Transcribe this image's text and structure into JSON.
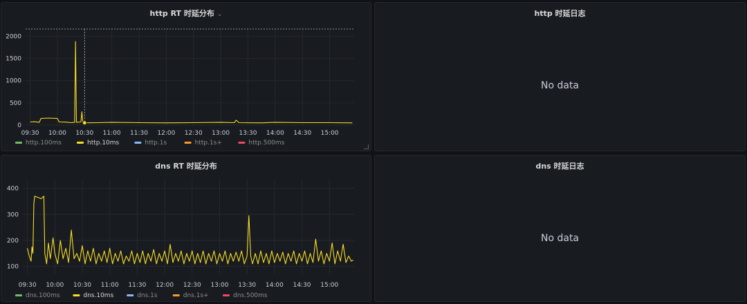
{
  "panels": {
    "http_rt": {
      "title": "http RT 时延分布"
    },
    "http_log": {
      "title": "http 时延日志",
      "empty_text": "No data"
    },
    "dns_rt": {
      "title": "dns RT 时延分布"
    },
    "dns_log": {
      "title": "dns 时延日志",
      "empty_text": "No data"
    }
  },
  "colors": {
    "series_100ms": "#73bf69",
    "series_10ms": "#fade2a",
    "series_1s": "#8ab8ff",
    "series_1s_plus": "#ff9830",
    "series_500ms": "#f2495c"
  },
  "chart_data": [
    {
      "type": "line",
      "title": "http RT 时延分布",
      "x_ticks": [
        "09:30",
        "10:00",
        "10:30",
        "11:00",
        "11:30",
        "12:00",
        "12:30",
        "13:00",
        "13:30",
        "14:00",
        "14:30",
        "15:00"
      ],
      "y_ticks": [
        0,
        500,
        1000,
        1500,
        2000
      ],
      "ylim": [
        0,
        2100
      ],
      "grid": true,
      "legend_placement": "bottom-left",
      "hover_time": "10:30",
      "series": [
        {
          "name": "http.100ms",
          "color": "#73bf69",
          "values": []
        },
        {
          "name": "http.10ms",
          "color": "#fade2a",
          "values": [
            [
              "09:30",
              70
            ],
            [
              "09:35",
              75
            ],
            [
              "09:40",
              60
            ],
            [
              "09:42",
              150
            ],
            [
              "09:50",
              155
            ],
            [
              "10:00",
              150
            ],
            [
              "10:02",
              70
            ],
            [
              "10:10",
              65
            ],
            [
              "10:15",
              55
            ],
            [
              "10:19",
              60
            ],
            [
              "10:20",
              1880
            ],
            [
              "10:21",
              60
            ],
            [
              "10:26",
              70
            ],
            [
              "10:27",
              300
            ],
            [
              "10:28",
              60
            ],
            [
              "10:30",
              50
            ],
            [
              "10:45",
              55
            ],
            [
              "11:00",
              60
            ],
            [
              "11:30",
              55
            ],
            [
              "12:00",
              50
            ],
            [
              "12:30",
              55
            ],
            [
              "13:00",
              60
            ],
            [
              "13:15",
              55
            ],
            [
              "13:17",
              110
            ],
            [
              "13:20",
              55
            ],
            [
              "13:45",
              50
            ],
            [
              "14:00",
              60
            ],
            [
              "14:30",
              55
            ],
            [
              "15:00",
              55
            ],
            [
              "15:25",
              50
            ]
          ]
        },
        {
          "name": "http.1s",
          "color": "#8ab8ff",
          "values": []
        },
        {
          "name": "http.1s+",
          "color": "#ff9830",
          "values": []
        },
        {
          "name": "http.500ms",
          "color": "#f2495c",
          "values": []
        }
      ]
    },
    {
      "type": "line",
      "title": "dns RT 时延分布",
      "x_ticks": [
        "09:30",
        "10:00",
        "10:30",
        "11:00",
        "11:30",
        "12:00",
        "12:30",
        "13:00",
        "13:30",
        "14:00",
        "14:30",
        "15:00"
      ],
      "y_ticks": [
        100,
        200,
        300,
        400
      ],
      "ylim": [
        70,
        420
      ],
      "grid": true,
      "legend_placement": "bottom-left",
      "series": [
        {
          "name": "dns.100ms",
          "color": "#73bf69",
          "values": []
        },
        {
          "name": "dns.10ms",
          "color": "#fade2a",
          "values": [
            [
              "09:30",
              170
            ],
            [
              "09:32",
              140
            ],
            [
              "09:34",
              120
            ],
            [
              "09:35",
              175
            ],
            [
              "09:36",
              150
            ],
            [
              "09:37",
              340
            ],
            [
              "09:38",
              370
            ],
            [
              "09:45",
              360
            ],
            [
              "09:48",
              370
            ],
            [
              "09:49",
              150
            ],
            [
              "09:51",
              110
            ],
            [
              "09:53",
              190
            ],
            [
              "09:55",
              130
            ],
            [
              "09:58",
              210
            ],
            [
              "10:00",
              150
            ],
            [
              "10:03",
              110
            ],
            [
              "10:06",
              200
            ],
            [
              "10:09",
              130
            ],
            [
              "10:12",
              170
            ],
            [
              "10:15",
              115
            ],
            [
              "10:18",
              240
            ],
            [
              "10:21",
              130
            ],
            [
              "10:24",
              150
            ],
            [
              "10:27",
              120
            ],
            [
              "10:30",
              180
            ],
            [
              "10:33",
              110
            ],
            [
              "10:36",
              160
            ],
            [
              "10:39",
              120
            ],
            [
              "10:42",
              170
            ],
            [
              "10:45",
              110
            ],
            [
              "10:48",
              150
            ],
            [
              "10:51",
              120
            ],
            [
              "10:54",
              160
            ],
            [
              "10:57",
              115
            ],
            [
              "11:00",
              170
            ],
            [
              "11:03",
              110
            ],
            [
              "11:06",
              150
            ],
            [
              "11:09",
              120
            ],
            [
              "11:12",
              160
            ],
            [
              "11:15",
              110
            ],
            [
              "11:18",
              140
            ],
            [
              "11:21",
              120
            ],
            [
              "11:24",
              160
            ],
            [
              "11:27",
              110
            ],
            [
              "11:30",
              150
            ],
            [
              "11:33",
              115
            ],
            [
              "11:36",
              160
            ],
            [
              "11:39",
              110
            ],
            [
              "11:42",
              150
            ],
            [
              "11:45",
              120
            ],
            [
              "11:48",
              165
            ],
            [
              "11:51",
              110
            ],
            [
              "11:54",
              150
            ],
            [
              "11:57",
              120
            ],
            [
              "12:00",
              160
            ],
            [
              "12:03",
              110
            ],
            [
              "12:06",
              185
            ],
            [
              "12:09",
              115
            ],
            [
              "12:12",
              150
            ],
            [
              "12:15",
              120
            ],
            [
              "12:18",
              160
            ],
            [
              "12:21",
              110
            ],
            [
              "12:24",
              150
            ],
            [
              "12:27",
              120
            ],
            [
              "12:30",
              160
            ],
            [
              "12:33",
              110
            ],
            [
              "12:36",
              150
            ],
            [
              "12:39",
              115
            ],
            [
              "12:42",
              160
            ],
            [
              "12:45",
              110
            ],
            [
              "12:48",
              150
            ],
            [
              "12:51",
              120
            ],
            [
              "12:54",
              160
            ],
            [
              "12:57",
              110
            ],
            [
              "13:00",
              150
            ],
            [
              "13:03",
              120
            ],
            [
              "13:06",
              160
            ],
            [
              "13:09",
              110
            ],
            [
              "13:12",
              150
            ],
            [
              "13:15",
              120
            ],
            [
              "13:18",
              155
            ],
            [
              "13:21",
              120
            ],
            [
              "13:24",
              160
            ],
            [
              "13:27",
              110
            ],
            [
              "13:30",
              140
            ],
            [
              "13:32",
              295
            ],
            [
              "13:34",
              140
            ],
            [
              "13:36",
              110
            ],
            [
              "13:39",
              150
            ],
            [
              "13:42",
              110
            ],
            [
              "13:45",
              160
            ],
            [
              "13:48",
              115
            ],
            [
              "13:51",
              150
            ],
            [
              "13:54",
              110
            ],
            [
              "13:57",
              160
            ],
            [
              "14:00",
              115
            ],
            [
              "14:03",
              150
            ],
            [
              "14:06",
              120
            ],
            [
              "14:09",
              155
            ],
            [
              "14:12",
              110
            ],
            [
              "14:15",
              150
            ],
            [
              "14:18",
              120
            ],
            [
              "14:21",
              160
            ],
            [
              "14:24",
              110
            ],
            [
              "14:27",
              150
            ],
            [
              "14:30",
              120
            ],
            [
              "14:33",
              160
            ],
            [
              "14:36",
              110
            ],
            [
              "14:39",
              150
            ],
            [
              "14:42",
              115
            ],
            [
              "14:45",
              205
            ],
            [
              "14:48",
              120
            ],
            [
              "14:51",
              160
            ],
            [
              "14:54",
              110
            ],
            [
              "14:57",
              150
            ],
            [
              "15:00",
              120
            ],
            [
              "15:03",
              190
            ],
            [
              "15:06",
              110
            ],
            [
              "15:09",
              160
            ],
            [
              "15:12",
              120
            ],
            [
              "15:15",
              185
            ],
            [
              "15:18",
              115
            ],
            [
              "15:21",
              140
            ],
            [
              "15:24",
              120
            ],
            [
              "15:26",
              125
            ]
          ]
        },
        {
          "name": "dns.1s",
          "color": "#8ab8ff",
          "values": []
        },
        {
          "name": "dns.1s+",
          "color": "#ff9830",
          "values": []
        },
        {
          "name": "dns.500ms",
          "color": "#f2495c",
          "values": []
        }
      ]
    }
  ]
}
